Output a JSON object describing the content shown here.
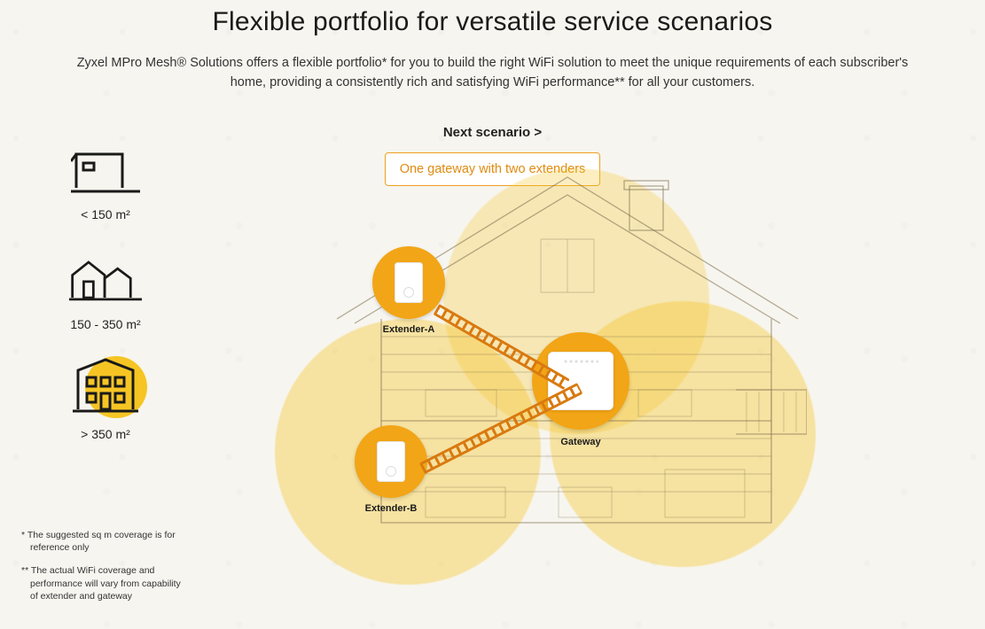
{
  "header": {
    "title": "Flexible portfolio for versatile service scenarios",
    "subtitle": "Zyxel MPro Mesh® Solutions offers a flexible portfolio* for you to build the right WiFi solution to meet the unique requirements of each subscriber's home, providing a consistently rich and satisfying WiFi performance** for all your customers."
  },
  "controls": {
    "next_label": "Next scenario  >",
    "scenario_pill": "One gateway with two extenders"
  },
  "sidebar": {
    "options": [
      {
        "id": "small",
        "label_html": "< 150 m²",
        "active": false
      },
      {
        "id": "medium",
        "label_html": "150 - 350 m²",
        "active": false
      },
      {
        "id": "large",
        "label_html": "> 350 m²",
        "active": true
      }
    ]
  },
  "diagram": {
    "devices": {
      "extender_a": "Extender-A",
      "extender_b": "Extender-B",
      "gateway": "Gateway"
    }
  },
  "footnotes": {
    "n1": "*  The suggested sq m coverage is for reference only",
    "n2": "** The actual WiFi coverage and performance will vary from capability of extender and gateway"
  },
  "colors": {
    "accent": "#f2a516",
    "accent_light": "#f6c524",
    "pill_border": "#f0a020",
    "pill_text": "#e08b10"
  }
}
